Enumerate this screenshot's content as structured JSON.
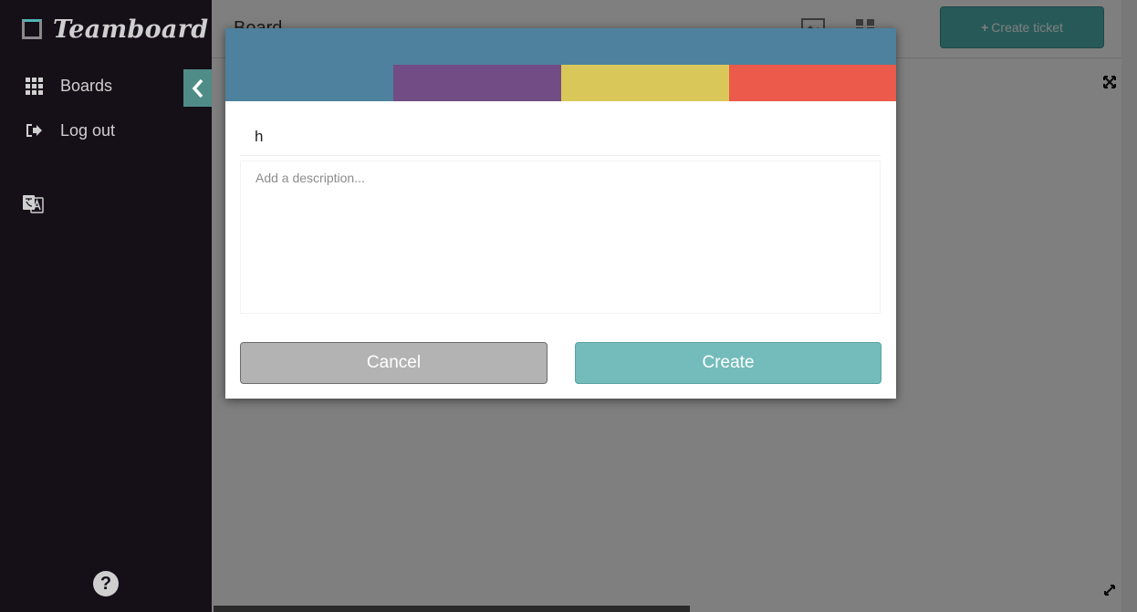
{
  "app": {
    "name": "Teamboard"
  },
  "sidebar": {
    "items": [
      {
        "label": "Boards",
        "icon": "grid-icon"
      },
      {
        "label": "Log out",
        "icon": "logout-icon"
      }
    ],
    "language_icon": "translate-icon",
    "help_icon": "help-icon",
    "help_glyph": "?",
    "collapse_icon": "chevron-left-icon"
  },
  "topbar": {
    "title": "Board",
    "create_ticket_label": "Create ticket"
  },
  "dialog": {
    "colors": [
      "#4d819d",
      "#724c85",
      "#dac75a",
      "#eb5a4b"
    ],
    "title_value": "h",
    "description_placeholder": "Add a description...",
    "cancel_label": "Cancel",
    "create_label": "Create"
  }
}
